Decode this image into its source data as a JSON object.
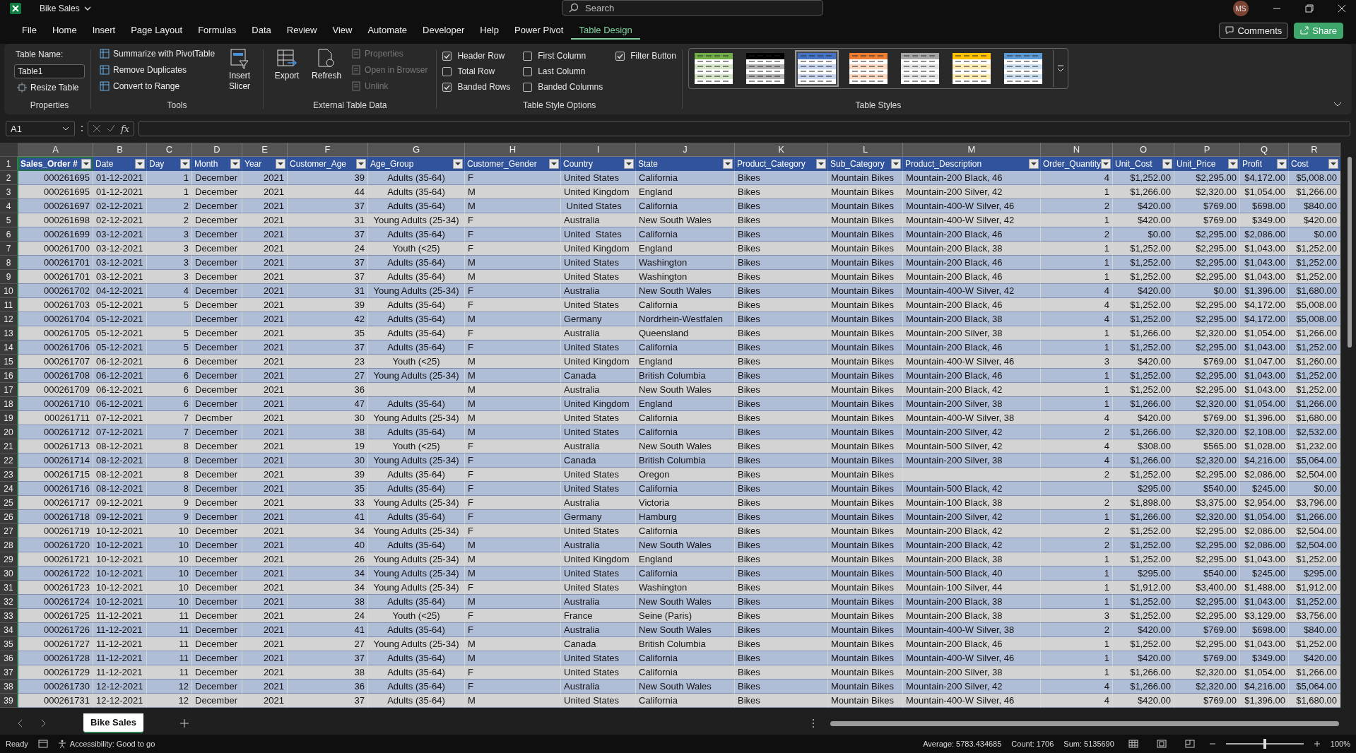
{
  "window": {
    "title": "Bike Sales",
    "search": {
      "placeholder": "Search"
    },
    "avatar": "MS"
  },
  "menu_tabs": [
    {
      "label": "File",
      "selected": false
    },
    {
      "label": "Home",
      "selected": false
    },
    {
      "label": "Insert",
      "selected": false
    },
    {
      "label": "Page Layout",
      "selected": false
    },
    {
      "label": "Formulas",
      "selected": false
    },
    {
      "label": "Data",
      "selected": false
    },
    {
      "label": "Review",
      "selected": false
    },
    {
      "label": "View",
      "selected": false
    },
    {
      "label": "Automate",
      "selected": false
    },
    {
      "label": "Developer",
      "selected": false
    },
    {
      "label": "Help",
      "selected": false
    },
    {
      "label": "Power Pivot",
      "selected": false
    },
    {
      "label": "Table Design",
      "selected": true
    }
  ],
  "header_buttons": {
    "comments": "Comments",
    "share": "Share"
  },
  "ribbon": {
    "properties": {
      "label": "Properties",
      "table_name_label": "Table Name:",
      "table_name": "Table1",
      "resize": "Resize Table"
    },
    "tools": {
      "label": "Tools",
      "items": [
        "Summarize with PivotTable",
        "Remove Duplicates",
        "Convert to Range"
      ],
      "insert_slicer": "Insert Slicer"
    },
    "external": {
      "label": "External Table Data",
      "export": "Export",
      "refresh": "Refresh",
      "items": [
        {
          "label": "Properties",
          "disabled": true
        },
        {
          "label": "Open in Browser",
          "disabled": true
        },
        {
          "label": "Unlink",
          "disabled": true
        }
      ]
    },
    "style_options": {
      "label": "Table Style Options",
      "options": [
        {
          "label": "Header Row",
          "checked": true
        },
        {
          "label": "Total Row",
          "checked": false
        },
        {
          "label": "Banded Rows",
          "checked": true
        },
        {
          "label": "First Column",
          "checked": false
        },
        {
          "label": "Last Column",
          "checked": false
        },
        {
          "label": "Banded Columns",
          "checked": false
        },
        {
          "label": "Filter Button",
          "checked": true
        }
      ]
    },
    "table_styles": {
      "label": "Table Styles",
      "swatches": [
        {
          "color": "#70ad47",
          "selected": false
        },
        {
          "color": "#000000",
          "selected": false
        },
        {
          "color": "#4472c4",
          "selected": true
        },
        {
          "color": "#ed7d31",
          "selected": false
        },
        {
          "color": "#a5a5a5",
          "selected": false
        },
        {
          "color": "#ffc000",
          "selected": false
        },
        {
          "color": "#5b9bd5",
          "selected": false
        }
      ]
    }
  },
  "formula_bar": {
    "name_box": "A1",
    "function_label": "fx"
  },
  "sheet": {
    "column_letters": [
      "A",
      "B",
      "C",
      "D",
      "E",
      "F",
      "G",
      "H",
      "I",
      "J",
      "K",
      "L",
      "M",
      "N",
      "O",
      "P",
      "Q",
      "R"
    ],
    "header_row_number": "1",
    "headers": [
      "Sales_Order #",
      "Date",
      "Day",
      "Month",
      "Year",
      "Customer_Age",
      "Age_Group",
      "Customer_Gender",
      "Country",
      "State",
      "Product_Category",
      "Sub_Category",
      "Product_Description",
      "Order_Quantity",
      "Unit_Cost",
      "Unit_Price",
      "Profit",
      "Cost"
    ],
    "rows": [
      {
        "n": "2",
        "cells": [
          "000261695",
          "01-12-2021",
          "1",
          "December",
          "2021",
          "39",
          "Adults (35-64)",
          "F",
          "United States",
          "California",
          "Bikes",
          "Mountain Bikes",
          "Mountain-200 Black, 46",
          "4",
          "$1,252.00",
          "$2,295.00",
          "$4,172.00",
          "$5,008.00"
        ]
      },
      {
        "n": "3",
        "cells": [
          "000261695",
          "01-12-2021",
          "1",
          "December",
          "2021",
          "44",
          "Adults (35-64)",
          "M",
          "United Kingdom",
          "England",
          "Bikes",
          "Mountain Bikes",
          "Mountain-200 Silver, 42",
          "1",
          "$1,266.00",
          "$2,320.00",
          "$1,054.00",
          "$1,266.00"
        ]
      },
      {
        "n": "4",
        "cells": [
          "000261697",
          "02-12-2021",
          "2",
          "December",
          "2021",
          "37",
          "Adults (35-64)",
          "M",
          " United States",
          "California",
          "Bikes",
          "Mountain Bikes",
          "Mountain-400-W Silver, 46",
          "2",
          "$420.00",
          "$769.00",
          "$698.00",
          "$840.00"
        ]
      },
      {
        "n": "5",
        "cells": [
          "000261698",
          "02-12-2021",
          "2",
          "December",
          "2021",
          "31",
          "Young Adults (25-34)",
          "F",
          "Australia",
          "New South Wales",
          "Bikes",
          "Mountain Bikes",
          "Mountain-400-W Silver, 42",
          "1",
          "$420.00",
          "$769.00",
          "$349.00",
          "$420.00"
        ]
      },
      {
        "n": "6",
        "cells": [
          "000261699",
          "03-12-2021",
          "3",
          "December",
          "2021",
          "37",
          "Adults (35-64)",
          "F",
          "United  States",
          "California",
          "Bikes",
          "Mountain Bikes",
          "Mountain-200 Black, 46",
          "2",
          "$0.00",
          "$2,295.00",
          "$2,086.00",
          "$0.00"
        ]
      },
      {
        "n": "7",
        "cells": [
          "000261700",
          "03-12-2021",
          "3",
          "December",
          "2021",
          "24",
          "Youth (<25)",
          "F",
          "United Kingdom",
          "England",
          "Bikes",
          "Mountain Bikes",
          "Mountain-200 Black, 38",
          "1",
          "$1,252.00",
          "$2,295.00",
          "$1,043.00",
          "$1,252.00"
        ]
      },
      {
        "n": "8",
        "cells": [
          "000261701",
          "03-12-2021",
          "3",
          "December",
          "2021",
          "37",
          "Adults (35-64)",
          "M",
          "United States",
          "Washington",
          "Bikes",
          "Mountain Bikes",
          "Mountain-200 Black, 46",
          "1",
          "$1,252.00",
          "$2,295.00",
          "$1,043.00",
          "$1,252.00"
        ]
      },
      {
        "n": "9",
        "cells": [
          "000261701",
          "03-12-2021",
          "3",
          "December",
          "2021",
          "37",
          "Adults (35-64)",
          "M",
          "United States",
          "Washington",
          "Bikes",
          "Mountain Bikes",
          "Mountain-200 Black, 46",
          "1",
          "$1,252.00",
          "$2,295.00",
          "$1,043.00",
          "$1,252.00"
        ]
      },
      {
        "n": "10",
        "cells": [
          "000261702",
          "04-12-2021",
          "4",
          "December",
          "2021",
          "31",
          "Young Adults (25-34)",
          "F",
          "Australia",
          "New South Wales",
          "Bikes",
          "Mountain Bikes",
          "Mountain-400-W Silver, 42",
          "4",
          "$420.00",
          "$0.00",
          "$1,396.00",
          "$1,680.00"
        ]
      },
      {
        "n": "11",
        "cells": [
          "000261703",
          "05-12-2021",
          "5",
          "December",
          "2021",
          "39",
          "Adults (35-64)",
          "F",
          "United States",
          "California",
          "Bikes",
          "Mountain Bikes",
          "Mountain-200 Black, 46",
          "4",
          "$1,252.00",
          "$2,295.00",
          "$4,172.00",
          "$5,008.00"
        ]
      },
      {
        "n": "12",
        "cells": [
          "000261704",
          "05-12-2021",
          null,
          "December",
          "2021",
          "42",
          "Adults (35-64)",
          "M",
          "Germany",
          "Nordrhein-Westfalen",
          "Bikes",
          "Mountain Bikes",
          "Mountain-200 Black, 38",
          "4",
          "$1,252.00",
          "$2,295.00",
          "$4,172.00",
          "$5,008.00"
        ]
      },
      {
        "n": "13",
        "cells": [
          "000261705",
          "05-12-2021",
          "5",
          "December",
          "2021",
          "35",
          "Adults (35-64)",
          "F",
          "Australia",
          "Queensland",
          "Bikes",
          "Mountain Bikes",
          "Mountain-200 Silver, 38",
          "1",
          "$1,266.00",
          "$2,320.00",
          "$1,054.00",
          "$1,266.00"
        ]
      },
      {
        "n": "14",
        "cells": [
          "000261706",
          "05-12-2021",
          "5",
          "December",
          "2021",
          "37",
          "Adults (35-64)",
          "F",
          "United States",
          "California",
          "Bikes",
          "Mountain Bikes",
          "Mountain-200 Black, 46",
          "1",
          "$1,252.00",
          "$2,295.00",
          "$1,043.00",
          "$1,252.00"
        ]
      },
      {
        "n": "15",
        "cells": [
          "000261707",
          "06-12-2021",
          "6",
          "December",
          "2021",
          "23",
          "Youth (<25)",
          "M",
          "United Kingdom",
          "England",
          "Bikes",
          "Mountain Bikes",
          "Mountain-400-W Silver, 46",
          "3",
          "$420.00",
          "$769.00",
          "$1,047.00",
          "$1,260.00"
        ]
      },
      {
        "n": "16",
        "cells": [
          "000261708",
          "06-12-2021",
          "6",
          "December",
          "2021",
          "27",
          "Young Adults (25-34)",
          "M",
          "Canada",
          "British Columbia",
          "Bikes",
          "Mountain Bikes",
          "Mountain-200 Black, 46",
          "1",
          "$1,252.00",
          "$2,295.00",
          "$1,043.00",
          "$1,252.00"
        ]
      },
      {
        "n": "17",
        "cells": [
          "000261709",
          "06-12-2021",
          "6",
          "December",
          "2021",
          "36",
          null,
          "M",
          "Australia",
          "New South Wales",
          "Bikes",
          "Mountain Bikes",
          "Mountain-200 Black, 42",
          "1",
          "$1,252.00",
          "$2,295.00",
          "$1,043.00",
          "$1,252.00"
        ]
      },
      {
        "n": "18",
        "cells": [
          "000261710",
          "06-12-2021",
          "6",
          "December",
          "2021",
          "47",
          "Adults (35-64)",
          "M",
          "United Kingdom",
          "England",
          "Bikes",
          "Mountain Bikes",
          "Mountain-200 Silver, 38",
          "1",
          "$1,266.00",
          "$2,320.00",
          "$1,054.00",
          "$1,266.00"
        ]
      },
      {
        "n": "19",
        "cells": [
          "000261711",
          "07-12-2021",
          "7",
          "Decmber",
          "2021",
          "30",
          "Young Adults (25-34)",
          "M",
          "United States",
          "California",
          "Bikes",
          "Mountain Bikes",
          "Mountain-400-W Silver, 38",
          "4",
          "$420.00",
          "$769.00",
          "$1,396.00",
          "$1,680.00"
        ]
      },
      {
        "n": "20",
        "cells": [
          "000261712",
          "07-12-2021",
          "7",
          "December",
          "2021",
          "38",
          "Adults (35-64)",
          "M",
          "United States",
          "California",
          "Bikes",
          "Mountain Bikes",
          "Mountain-200 Silver, 42",
          "2",
          "$1,266.00",
          "$2,320.00",
          "$2,108.00",
          "$2,532.00"
        ]
      },
      {
        "n": "21",
        "cells": [
          "000261713",
          "08-12-2021",
          "8",
          "December",
          "2021",
          "19",
          "Youth (<25)",
          "F",
          "Australia",
          "New South Wales",
          "Bikes",
          "Mountain Bikes",
          "Mountain-500 Silver, 42",
          "4",
          "$308.00",
          "$565.00",
          "$1,028.00",
          "$1,232.00"
        ]
      },
      {
        "n": "22",
        "cells": [
          "000261714",
          "08-12-2021",
          "8",
          "December",
          "2021",
          "30",
          "Young Adults (25-34)",
          "F",
          "Canada",
          "British Columbia",
          "Bikes",
          "Mountain Bikes",
          "Mountain-200 Silver, 38",
          "4",
          "$1,266.00",
          "$2,320.00",
          "$4,216.00",
          "$5,064.00"
        ]
      },
      {
        "n": "23",
        "cells": [
          "000261715",
          "08-12-2021",
          "8",
          "December",
          "2021",
          "39",
          "Adults (35-64)",
          "F",
          "United States",
          "Oregon",
          "Bikes",
          "Mountain Bikes",
          null,
          "2",
          "$1,252.00",
          "$2,295.00",
          "$2,086.00",
          "$2,504.00"
        ]
      },
      {
        "n": "24",
        "cells": [
          "000261716",
          "08-12-2021",
          "8",
          "December",
          "2021",
          "35",
          "Adults (35-64)",
          "F",
          "United States",
          "California",
          "Bikes",
          "Mountain Bikes",
          "Mountain-500 Black, 42",
          null,
          "$295.00",
          "$540.00",
          "$245.00",
          "$0.00"
        ]
      },
      {
        "n": "25",
        "cells": [
          "000261717",
          "09-12-2021",
          "9",
          "December",
          "2021",
          "33",
          "Young Adults (25-34)",
          "F",
          "Australia",
          "Victoria",
          "Bikes",
          "Mountain Bikes",
          "Mountain-100 Black, 38",
          "2",
          "$1,898.00",
          "$3,375.00",
          "$2,954.00",
          "$3,796.00"
        ]
      },
      {
        "n": "26",
        "cells": [
          "000261718",
          "09-12-2021",
          "9",
          "December",
          "2021",
          "41",
          "Adults (35-64)",
          "F",
          "Germany",
          "Hamburg",
          "Bikes",
          "Mountain Bikes",
          "Mountain-200 Silver, 42",
          "1",
          "$1,266.00",
          "$2,320.00",
          "$1,054.00",
          "$1,266.00"
        ]
      },
      {
        "n": "27",
        "cells": [
          "000261719",
          "10-12-2021",
          "10",
          "December",
          "2021",
          "34",
          "Young Adults (25-34)",
          "F",
          "United States",
          "California",
          "Bikes",
          "Mountain Bikes",
          "Mountain-200 Black, 42",
          "2",
          "$1,252.00",
          "$2,295.00",
          "$2,086.00",
          "$2,504.00"
        ]
      },
      {
        "n": "28",
        "cells": [
          "000261720",
          "10-12-2021",
          "10",
          "December",
          "2021",
          "40",
          "Adults (35-64)",
          "M",
          "Australia",
          "New South Wales",
          "Bikes",
          "Mountain Bikes",
          "Mountain-200 Black, 42",
          "2",
          "$1,252.00",
          "$2,295.00",
          "$2,086.00",
          "$2,504.00"
        ]
      },
      {
        "n": "29",
        "cells": [
          "000261721",
          "10-12-2021",
          "10",
          "December",
          "2021",
          "26",
          "Young Adults (25-34)",
          "M",
          "United Kingdom",
          "England",
          "Bikes",
          "Mountain Bikes",
          "Mountain-200 Black, 38",
          "1",
          "$1,252.00",
          "$2,295.00",
          "$1,043.00",
          "$1,252.00"
        ]
      },
      {
        "n": "30",
        "cells": [
          "000261722",
          "10-12-2021",
          "10",
          "December",
          "2021",
          "34",
          "Young Adults (25-34)",
          "M",
          "United States",
          "California",
          "Bikes",
          "Mountain Bikes",
          "Mountain-500 Black, 40",
          "1",
          "$295.00",
          "$540.00",
          "$245.00",
          "$295.00"
        ]
      },
      {
        "n": "31",
        "cells": [
          "000261723",
          "10-12-2021",
          "10",
          "December",
          "2021",
          "34",
          "Young Adults (25-34)",
          "F",
          "United States",
          "Washington",
          "Bikes",
          "Mountain Bikes",
          "Mountain-100 Silver, 44",
          "1",
          "$1,912.00",
          "$3,400.00",
          "$1,488.00",
          "$1,912.00"
        ]
      },
      {
        "n": "32",
        "cells": [
          "000261724",
          "10-12-2021",
          "10",
          "December",
          "2021",
          "38",
          "Adults (35-64)",
          "M",
          "Australia",
          "New South Wales",
          "Bikes",
          "Mountain Bikes",
          "Mountain-200 Black, 38",
          "1",
          "$1,252.00",
          "$2,295.00",
          "$1,043.00",
          "$1,252.00"
        ]
      },
      {
        "n": "33",
        "cells": [
          "000261725",
          "11-12-2021",
          "11",
          "December",
          "2021",
          "24",
          "Youth (<25)",
          "F",
          "France",
          "Seine (Paris)",
          "Bikes",
          "Mountain Bikes",
          "Mountain-200 Black, 38",
          "3",
          "$1,252.00",
          "$2,295.00",
          "$3,129.00",
          "$3,756.00"
        ]
      },
      {
        "n": "34",
        "cells": [
          "000261726",
          "11-12-2021",
          "11",
          "December",
          "2021",
          "41",
          "Adults (35-64)",
          "F",
          "Australia",
          "New South Wales",
          "Bikes",
          "Mountain Bikes",
          "Mountain-400-W Silver, 38",
          "2",
          "$420.00",
          "$769.00",
          "$698.00",
          "$840.00"
        ]
      },
      {
        "n": "35",
        "cells": [
          "000261727",
          "11-12-2021",
          "11",
          "December",
          "2021",
          "27",
          "Young Adults (25-34)",
          "M",
          "Canada",
          "British Columbia",
          "Bikes",
          "Mountain Bikes",
          "Mountain-200 Black, 46",
          "1",
          "$1,252.00",
          "$2,295.00",
          "$1,043.00",
          "$1,252.00"
        ]
      },
      {
        "n": "36",
        "cells": [
          "000261728",
          "11-12-2021",
          "11",
          "December",
          "2021",
          "37",
          "Adults (35-64)",
          "M",
          "United States",
          "California",
          "Bikes",
          "Mountain Bikes",
          "Mountain-400-W Silver, 46",
          "1",
          "$420.00",
          "$769.00",
          "$349.00",
          "$420.00"
        ]
      },
      {
        "n": "37",
        "cells": [
          "000261729",
          "11-12-2021",
          "11",
          "December",
          "2021",
          "38",
          "Adults (35-64)",
          "F",
          "United States",
          "California",
          "Bikes",
          "Mountain Bikes",
          "Mountain-200 Silver, 38",
          "1",
          "$1,266.00",
          "$2,320.00",
          "$1,054.00",
          "$1,266.00"
        ]
      },
      {
        "n": "38",
        "cells": [
          "000261730",
          "12-12-2021",
          "12",
          "December",
          "2021",
          "36",
          "Adults (35-64)",
          "F",
          "Australia",
          "New South Wales",
          "Bikes",
          "Mountain Bikes",
          "Mountain-200 Silver, 42",
          "4",
          "$1,266.00",
          "$2,320.00",
          "$4,216.00",
          "$5,064.00"
        ]
      },
      {
        "n": "39",
        "cells": [
          "000261731",
          "12-12-2021",
          "12",
          "December",
          "2021",
          "37",
          "Adults (35-64)",
          "M",
          "United States",
          "California",
          "Bikes",
          "Mountain Bikes",
          "Mountain-400-W Silver, 46",
          "4",
          "$420.00",
          "$769.00",
          "$1,396.00",
          "$1,680.00"
        ]
      }
    ]
  },
  "sheet_tabs": [
    {
      "label": "Bike Sales",
      "selected": true
    }
  ],
  "zoom_slider": {
    "level": 0.5
  },
  "status_bar": {
    "ready": "Ready",
    "accessibility": "Accessibility: Good to go",
    "average": "Average: 5783.434685",
    "count": "Count: 1706",
    "sum": "Sum: 5135690",
    "zoom": "100%"
  }
}
